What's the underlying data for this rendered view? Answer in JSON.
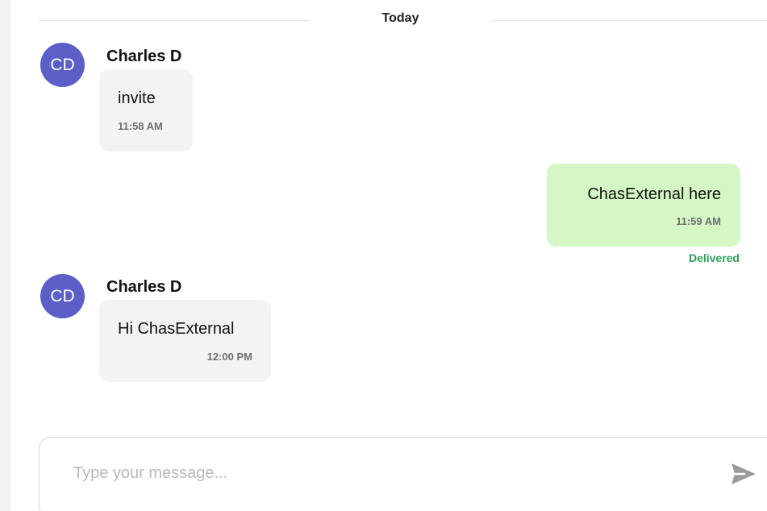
{
  "date_separator": {
    "label": "Today"
  },
  "messages": [
    {
      "direction": "incoming",
      "avatar_initials": "CD",
      "sender": "Charles D",
      "text": "invite",
      "time": "11:58 AM"
    },
    {
      "direction": "outgoing",
      "text": "ChasExternal here",
      "time": "11:59 AM",
      "status": "Delivered"
    },
    {
      "direction": "incoming",
      "avatar_initials": "CD",
      "sender": "Charles D",
      "text": "Hi ChasExternal",
      "time": "12:00 PM"
    }
  ],
  "composer": {
    "placeholder": "Type your message...",
    "value": "",
    "send_icon": "send-icon"
  },
  "colors": {
    "avatar": "#5b5fc7",
    "incoming_bubble": "#f3f3f3",
    "outgoing_bubble": "#d4f7c5",
    "delivered_status": "#2e9e55"
  }
}
